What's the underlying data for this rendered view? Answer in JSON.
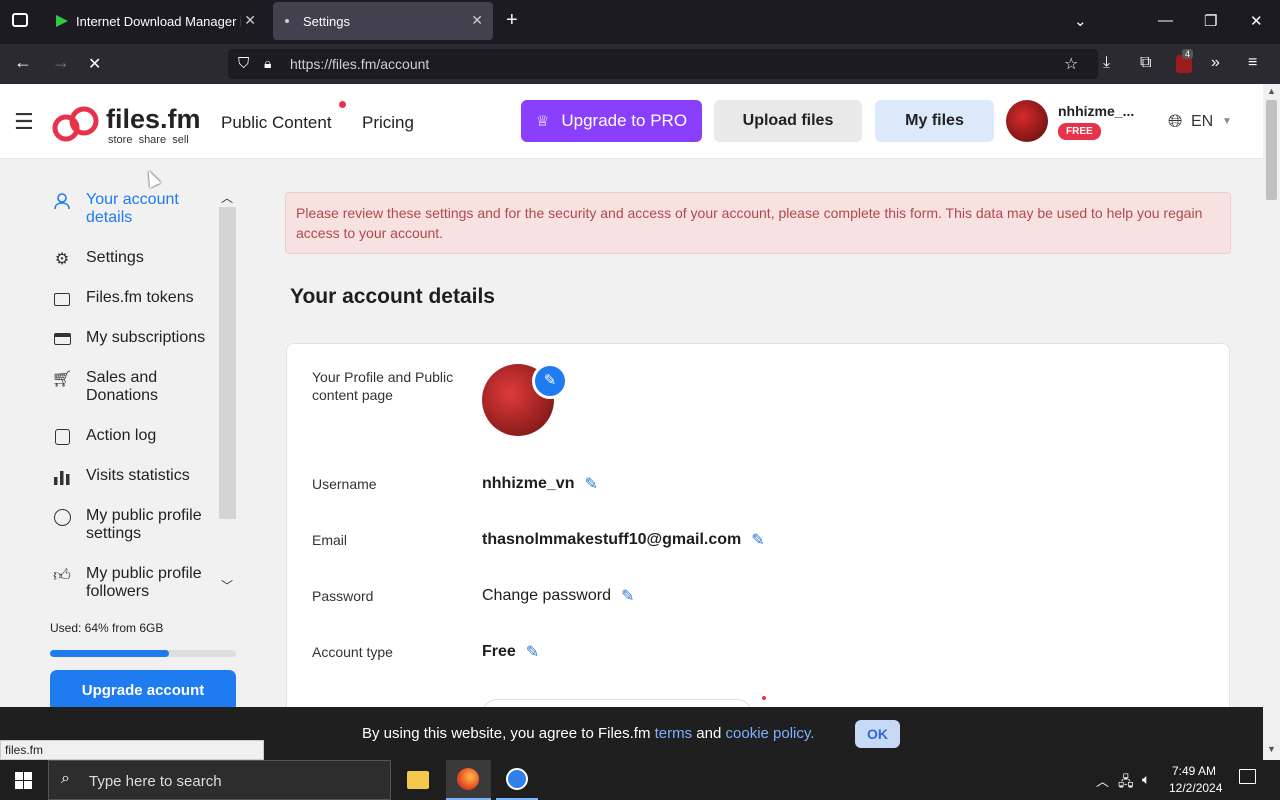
{
  "browser": {
    "tabs": [
      {
        "title": "Internet Download Manager is c"
      },
      {
        "title": "Settings"
      }
    ],
    "url": "https://files.fm/account",
    "extension_badge": "4",
    "status_url": "files.fm"
  },
  "header": {
    "logo_text": "files.fm",
    "logo_tagline": "store  share  sell",
    "nav": [
      "Public Content",
      "Pricing"
    ],
    "upgrade_label": "Upgrade to PRO",
    "upload_label": "Upload files",
    "myfiles_label": "My files",
    "username": "nhhizme_...",
    "plan_badge": "FREE",
    "language": "EN"
  },
  "sidebar": {
    "items": [
      {
        "label": "Your account details",
        "icon": "user-icon",
        "active": true
      },
      {
        "label": "Settings",
        "icon": "gear-icon"
      },
      {
        "label": "Files.fm tokens",
        "icon": "wallet-icon"
      },
      {
        "label": "My subscriptions",
        "icon": "card-icon"
      },
      {
        "label": "Sales and Donations",
        "icon": "cart-icon"
      },
      {
        "label": "Action log",
        "icon": "log-icon"
      },
      {
        "label": "Visits statistics",
        "icon": "bar-chart-icon"
      },
      {
        "label": "My public profile settings",
        "icon": "profile-circle-icon"
      },
      {
        "label": "My public profile followers",
        "icon": "thumbs-up-icon"
      }
    ],
    "storage_text": "Used: 64% from 6GB",
    "storage_used_fraction": 0.64,
    "upgrade_button": "Upgrade account"
  },
  "main": {
    "alert": "Please review these settings and for the security and access of your account, please complete this form. This data may be used to help you regain access to your account.",
    "title": "Your account details",
    "fields": {
      "profile_label": "Your Profile and Public content page",
      "username_label": "Username",
      "username_value": "nhhizme_vn",
      "email_label": "Email",
      "email_value": "thasnolmmakestuff10@gmail.com",
      "password_label": "Password",
      "password_value": "Change password",
      "account_type_label": "Account type",
      "account_type_value": "Free"
    }
  },
  "cookie": {
    "text_before": "By using this website, you agree to Files.fm ",
    "terms": "terms",
    "and": " and ",
    "policy": "cookie policy.",
    "ok": "OK"
  },
  "taskbar": {
    "search_placeholder": "Type here to search",
    "time": "7:49 AM",
    "date": "12/2/2024"
  },
  "colors": {
    "accent_purple": "#8a3ffc",
    "accent_blue": "#1e7bf0",
    "brand_red": "#e8324a"
  }
}
